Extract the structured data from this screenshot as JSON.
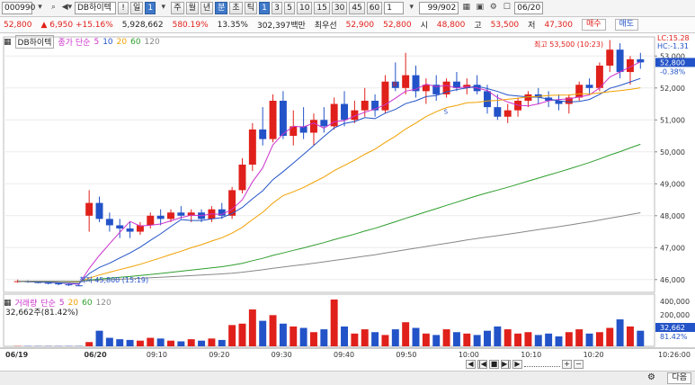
{
  "toolbar": {
    "code": "000990",
    "name": "DB하이텍",
    "period_d": "일",
    "period_active": "1",
    "periods": [
      "주",
      "월",
      "년",
      "분",
      "초",
      "틱"
    ],
    "minutes": [
      "1",
      "3",
      "5",
      "10",
      "15",
      "30",
      "45",
      "60"
    ],
    "count": "1",
    "range": "99/902",
    "date": "06/20"
  },
  "quote": {
    "price": "52,800",
    "arrow": "▲",
    "change": "6,950",
    "pct": "+15.16%",
    "volume": "5,928,662",
    "vol_pct": "580.19%",
    "turnover": "13.35%",
    "amount": "302,397백만",
    "best_label": "최우선",
    "best_ask": "52,900",
    "best_bid": "52,800",
    "open_label": "시",
    "open": "48,800",
    "high_label": "고",
    "high": "53,500",
    "low_label": "저",
    "low": "47,300",
    "buy": "매수",
    "sell": "매도"
  },
  "price_legend": {
    "name": "DB하이텍",
    "ma_label": "종가 단순",
    "ma": [
      "5",
      "10",
      "20",
      "60",
      "120"
    ]
  },
  "vol_legend": {
    "name": "거래량",
    "ma_label": "단순",
    "ma": [
      "5",
      "20",
      "60",
      "120"
    ],
    "value": "32,662주(81.42%)"
  },
  "annotations": {
    "high": "최고 53,500 (10:23)",
    "low": "최저 45,800 (15:19)",
    "lc": "LC:15.28",
    "hc": "HC:-1.31",
    "price_tag": "52,800",
    "price_pct": "-0.38%",
    "vol_tag": "32,662",
    "vol_pct": "81.42%",
    "marker_b": "B",
    "marker_s": "S"
  },
  "colors": {
    "up": "#e0201b",
    "down": "#2353c8",
    "ma5": "#cc33cc",
    "ma10": "#2353c8",
    "ma20": "#f0a000",
    "ma60": "#2e9e2e",
    "ma120": "#888888"
  },
  "chart_data": {
    "type": "candlestick",
    "price_axis": [
      "53,000",
      "52,000",
      "51,000",
      "50,000",
      "49,000",
      "48,000",
      "47,000",
      "46,000"
    ],
    "vol_axis": [
      "400,000",
      "200,000"
    ],
    "x_labels": [
      "06/19",
      "06/20",
      "09:10",
      "09:20",
      "09:30",
      "09:40",
      "09:50",
      "10:00",
      "10:10",
      "10:20",
      "10:26:00"
    ],
    "ylim": [
      45600,
      53600
    ],
    "candles": [
      [
        45950,
        46000,
        45900,
        45950
      ],
      [
        45950,
        45980,
        45900,
        45920
      ],
      [
        45920,
        45950,
        45880,
        45900
      ],
      [
        45900,
        45920,
        45850,
        45880
      ],
      [
        45880,
        45900,
        45820,
        45850
      ],
      [
        45850,
        45880,
        45800,
        45820
      ],
      [
        45820,
        45850,
        45790,
        45800
      ],
      [
        48000,
        48800,
        47500,
        48400
      ],
      [
        48400,
        48600,
        47800,
        47900
      ],
      [
        47900,
        48100,
        47500,
        47700
      ],
      [
        47700,
        47900,
        47300,
        47600
      ],
      [
        47600,
        47800,
        47300,
        47500
      ],
      [
        47500,
        47800,
        47400,
        47700
      ],
      [
        47700,
        48100,
        47600,
        48000
      ],
      [
        48000,
        48200,
        47700,
        47900
      ],
      [
        47900,
        48200,
        47800,
        48100
      ],
      [
        48100,
        48300,
        47900,
        48000
      ],
      [
        48000,
        48200,
        47800,
        48100
      ],
      [
        48100,
        48200,
        47800,
        47900
      ],
      [
        47900,
        48300,
        47800,
        48200
      ],
      [
        48200,
        48400,
        47900,
        48000
      ],
      [
        48000,
        48900,
        47900,
        48800
      ],
      [
        48800,
        49800,
        48700,
        49600
      ],
      [
        49600,
        50900,
        49400,
        50700
      ],
      [
        50700,
        51400,
        50200,
        50400
      ],
      [
        50400,
        51800,
        50300,
        51600
      ],
      [
        51600,
        51900,
        50400,
        50500
      ],
      [
        50500,
        51300,
        50200,
        50800
      ],
      [
        50800,
        51400,
        50400,
        50600
      ],
      [
        50600,
        51200,
        50200,
        51000
      ],
      [
        51000,
        51400,
        50600,
        50800
      ],
      [
        50800,
        51700,
        50700,
        51500
      ],
      [
        51500,
        51900,
        50800,
        51000
      ],
      [
        51000,
        51600,
        50900,
        51300
      ],
      [
        51300,
        52000,
        51100,
        51600
      ],
      [
        51600,
        51800,
        51100,
        51300
      ],
      [
        51300,
        52400,
        51200,
        52200
      ],
      [
        52200,
        52800,
        51900,
        52000
      ],
      [
        52000,
        53100,
        51800,
        52400
      ],
      [
        52400,
        52700,
        51700,
        51900
      ],
      [
        51900,
        52300,
        51500,
        52100
      ],
      [
        52100,
        52400,
        51600,
        51800
      ],
      [
        51800,
        52300,
        51700,
        52200
      ],
      [
        52200,
        52500,
        51900,
        52000
      ],
      [
        52000,
        52300,
        51800,
        52100
      ],
      [
        52100,
        52400,
        51800,
        51900
      ],
      [
        51900,
        52100,
        51200,
        51400
      ],
      [
        51400,
        51800,
        51000,
        51100
      ],
      [
        51100,
        51500,
        50900,
        51300
      ],
      [
        51300,
        51700,
        51100,
        51600
      ],
      [
        51600,
        51900,
        51400,
        51800
      ],
      [
        51800,
        52000,
        51500,
        51700
      ],
      [
        51700,
        51900,
        51400,
        51600
      ],
      [
        51600,
        51800,
        51300,
        51500
      ],
      [
        51500,
        51800,
        51200,
        51700
      ],
      [
        51700,
        52200,
        51600,
        52100
      ],
      [
        52100,
        52300,
        51800,
        52000
      ],
      [
        52000,
        52800,
        51900,
        52700
      ],
      [
        52700,
        53500,
        52500,
        53200
      ],
      [
        53200,
        53400,
        52300,
        52500
      ],
      [
        52500,
        53000,
        52100,
        52900
      ],
      [
        52900,
        53100,
        52600,
        52800
      ]
    ],
    "volumes": [
      2,
      2,
      2,
      2,
      2,
      2,
      2,
      30,
      110,
      60,
      50,
      45,
      40,
      60,
      55,
      40,
      35,
      50,
      40,
      55,
      45,
      150,
      160,
      260,
      180,
      220,
      160,
      140,
      130,
      100,
      120,
      330,
      140,
      90,
      120,
      100,
      80,
      120,
      170,
      130,
      90,
      80,
      120,
      100,
      90,
      80,
      110,
      140,
      120,
      90,
      100,
      80,
      90,
      70,
      100,
      120,
      90,
      100,
      130,
      190,
      140,
      110
    ]
  }
}
